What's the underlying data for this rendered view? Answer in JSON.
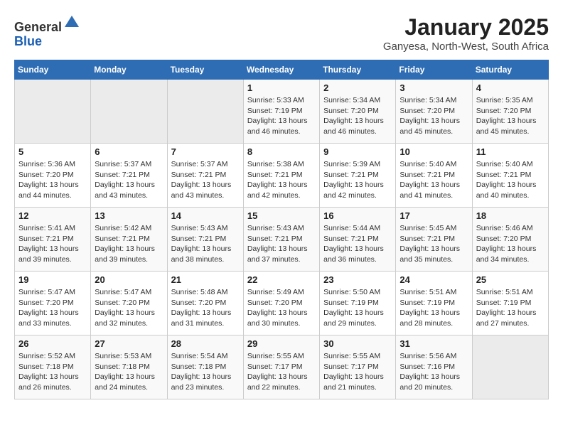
{
  "header": {
    "logo_line1": "General",
    "logo_line2": "Blue",
    "title": "January 2025",
    "subtitle": "Ganyesa, North-West, South Africa"
  },
  "weekdays": [
    "Sunday",
    "Monday",
    "Tuesday",
    "Wednesday",
    "Thursday",
    "Friday",
    "Saturday"
  ],
  "weeks": [
    [
      {
        "day": "",
        "info": ""
      },
      {
        "day": "",
        "info": ""
      },
      {
        "day": "",
        "info": ""
      },
      {
        "day": "1",
        "info": "Sunrise: 5:33 AM\nSunset: 7:19 PM\nDaylight: 13 hours\nand 46 minutes."
      },
      {
        "day": "2",
        "info": "Sunrise: 5:34 AM\nSunset: 7:20 PM\nDaylight: 13 hours\nand 46 minutes."
      },
      {
        "day": "3",
        "info": "Sunrise: 5:34 AM\nSunset: 7:20 PM\nDaylight: 13 hours\nand 45 minutes."
      },
      {
        "day": "4",
        "info": "Sunrise: 5:35 AM\nSunset: 7:20 PM\nDaylight: 13 hours\nand 45 minutes."
      }
    ],
    [
      {
        "day": "5",
        "info": "Sunrise: 5:36 AM\nSunset: 7:20 PM\nDaylight: 13 hours\nand 44 minutes."
      },
      {
        "day": "6",
        "info": "Sunrise: 5:37 AM\nSunset: 7:21 PM\nDaylight: 13 hours\nand 43 minutes."
      },
      {
        "day": "7",
        "info": "Sunrise: 5:37 AM\nSunset: 7:21 PM\nDaylight: 13 hours\nand 43 minutes."
      },
      {
        "day": "8",
        "info": "Sunrise: 5:38 AM\nSunset: 7:21 PM\nDaylight: 13 hours\nand 42 minutes."
      },
      {
        "day": "9",
        "info": "Sunrise: 5:39 AM\nSunset: 7:21 PM\nDaylight: 13 hours\nand 42 minutes."
      },
      {
        "day": "10",
        "info": "Sunrise: 5:40 AM\nSunset: 7:21 PM\nDaylight: 13 hours\nand 41 minutes."
      },
      {
        "day": "11",
        "info": "Sunrise: 5:40 AM\nSunset: 7:21 PM\nDaylight: 13 hours\nand 40 minutes."
      }
    ],
    [
      {
        "day": "12",
        "info": "Sunrise: 5:41 AM\nSunset: 7:21 PM\nDaylight: 13 hours\nand 39 minutes."
      },
      {
        "day": "13",
        "info": "Sunrise: 5:42 AM\nSunset: 7:21 PM\nDaylight: 13 hours\nand 39 minutes."
      },
      {
        "day": "14",
        "info": "Sunrise: 5:43 AM\nSunset: 7:21 PM\nDaylight: 13 hours\nand 38 minutes."
      },
      {
        "day": "15",
        "info": "Sunrise: 5:43 AM\nSunset: 7:21 PM\nDaylight: 13 hours\nand 37 minutes."
      },
      {
        "day": "16",
        "info": "Sunrise: 5:44 AM\nSunset: 7:21 PM\nDaylight: 13 hours\nand 36 minutes."
      },
      {
        "day": "17",
        "info": "Sunrise: 5:45 AM\nSunset: 7:21 PM\nDaylight: 13 hours\nand 35 minutes."
      },
      {
        "day": "18",
        "info": "Sunrise: 5:46 AM\nSunset: 7:20 PM\nDaylight: 13 hours\nand 34 minutes."
      }
    ],
    [
      {
        "day": "19",
        "info": "Sunrise: 5:47 AM\nSunset: 7:20 PM\nDaylight: 13 hours\nand 33 minutes."
      },
      {
        "day": "20",
        "info": "Sunrise: 5:47 AM\nSunset: 7:20 PM\nDaylight: 13 hours\nand 32 minutes."
      },
      {
        "day": "21",
        "info": "Sunrise: 5:48 AM\nSunset: 7:20 PM\nDaylight: 13 hours\nand 31 minutes."
      },
      {
        "day": "22",
        "info": "Sunrise: 5:49 AM\nSunset: 7:20 PM\nDaylight: 13 hours\nand 30 minutes."
      },
      {
        "day": "23",
        "info": "Sunrise: 5:50 AM\nSunset: 7:19 PM\nDaylight: 13 hours\nand 29 minutes."
      },
      {
        "day": "24",
        "info": "Sunrise: 5:51 AM\nSunset: 7:19 PM\nDaylight: 13 hours\nand 28 minutes."
      },
      {
        "day": "25",
        "info": "Sunrise: 5:51 AM\nSunset: 7:19 PM\nDaylight: 13 hours\nand 27 minutes."
      }
    ],
    [
      {
        "day": "26",
        "info": "Sunrise: 5:52 AM\nSunset: 7:18 PM\nDaylight: 13 hours\nand 26 minutes."
      },
      {
        "day": "27",
        "info": "Sunrise: 5:53 AM\nSunset: 7:18 PM\nDaylight: 13 hours\nand 24 minutes."
      },
      {
        "day": "28",
        "info": "Sunrise: 5:54 AM\nSunset: 7:18 PM\nDaylight: 13 hours\nand 23 minutes."
      },
      {
        "day": "29",
        "info": "Sunrise: 5:55 AM\nSunset: 7:17 PM\nDaylight: 13 hours\nand 22 minutes."
      },
      {
        "day": "30",
        "info": "Sunrise: 5:55 AM\nSunset: 7:17 PM\nDaylight: 13 hours\nand 21 minutes."
      },
      {
        "day": "31",
        "info": "Sunrise: 5:56 AM\nSunset: 7:16 PM\nDaylight: 13 hours\nand 20 minutes."
      },
      {
        "day": "",
        "info": ""
      }
    ]
  ]
}
